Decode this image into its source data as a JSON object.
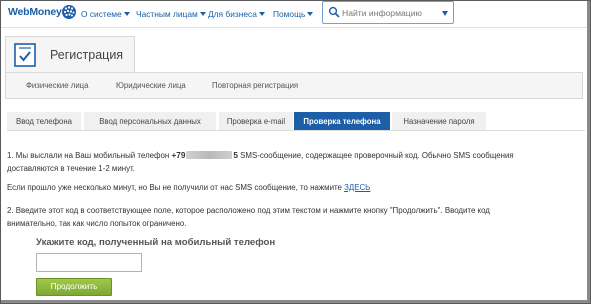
{
  "brand": {
    "name": "WebMoney"
  },
  "nav": [
    {
      "label": "О системе"
    },
    {
      "label": "Частным лицам"
    },
    {
      "label": "Для бизнеса"
    },
    {
      "label": "Помощь"
    }
  ],
  "search": {
    "placeholder": "Найти информацию"
  },
  "registration": {
    "title": "Регистрация",
    "sublinks": [
      {
        "label": "Физические лица"
      },
      {
        "label": "Юридические лица"
      },
      {
        "label": "Повторная регистрация"
      }
    ]
  },
  "steps": [
    {
      "label": "Ввод телефона",
      "active": false
    },
    {
      "label": "Ввод персональных данных",
      "active": false
    },
    {
      "label": "Проверка e-mail",
      "active": false
    },
    {
      "label": "Проверка телефона",
      "active": true
    },
    {
      "label": "Назначение пароля",
      "active": false
    }
  ],
  "content": {
    "p1_prefix": "1. Мы выслали на Ваш мобильный телефон ",
    "phone_start": "+79",
    "phone_end": "5",
    "p1_suffix": " SMS-сообщение, содержащее проверочный код. Обычно SMS сообщения",
    "p1_line2": "доставляются в течение 1-2 минут.",
    "p2_prefix": "Если прошло уже несколько минут, но Вы не получили от нас SMS сообщение, то нажмите ",
    "p2_link": "ЗДЕСЬ",
    "p3_line1": "2. Введите этот код в соответствующее поле, которое расположено под этим текстом и нажмите кнопку \"Продолжить\". Вводите код",
    "p3_line2": "внимательно, так как число попыток ограничено.",
    "code_label": "Укажите код, полученный на мобильный телефон",
    "code_value": "",
    "submit_label": "Продолжить"
  },
  "colors": {
    "brand_blue": "#1c5fa8",
    "active_tab": "#1c5fa8",
    "submit_green": "#8ab83e"
  },
  "icons": {
    "logo": "globe-icon",
    "search": "search-icon",
    "registration": "document-check-icon"
  }
}
